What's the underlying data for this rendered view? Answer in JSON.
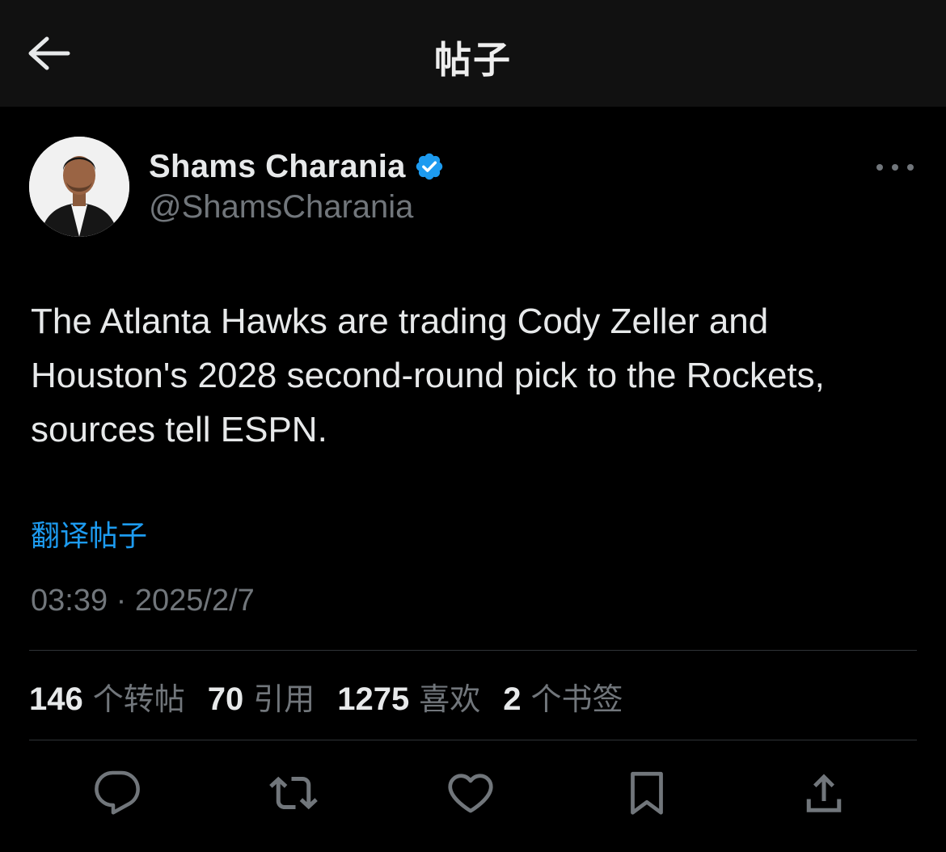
{
  "header": {
    "title": "帖子",
    "back_icon": "back-arrow-icon"
  },
  "author": {
    "display_name": "Shams Charania",
    "handle": "@ShamsCharania",
    "verified": true,
    "verified_color": "#1d9bf0"
  },
  "tweet": {
    "text": "The Atlanta Hawks are trading Cody Zeller and\nHouston's 2028 second-round pick to the Rockets,\nsources tell ESPN.",
    "translate_label": "翻译帖子",
    "timestamp": "03:39 · 2025/2/7"
  },
  "stats": [
    {
      "count": "146",
      "label": "个转帖"
    },
    {
      "count": "70",
      "label": "引用"
    },
    {
      "count": "1275",
      "label": "喜欢"
    },
    {
      "count": "2",
      "label": "个书签"
    }
  ],
  "actions": [
    "reply-icon",
    "retweet-icon",
    "like-icon",
    "bookmark-icon",
    "share-icon"
  ],
  "colors": {
    "background": "#000000",
    "header_bg": "#111111",
    "text_primary": "#e7e9ea",
    "text_secondary": "#71767b",
    "link": "#1d9bf0",
    "divider": "#2f3336"
  }
}
